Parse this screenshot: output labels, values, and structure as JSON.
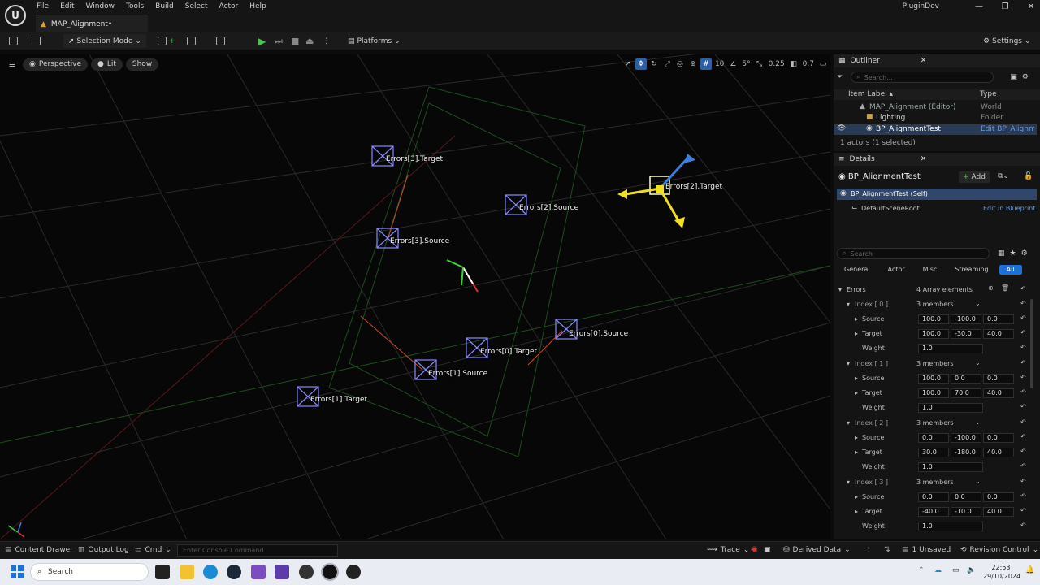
{
  "menu": [
    "File",
    "Edit",
    "Window",
    "Tools",
    "Build",
    "Select",
    "Actor",
    "Help"
  ],
  "tab_title": "MAP_Alignment•",
  "project_name": "PluginDev",
  "window_controls": [
    "—",
    "❐",
    "✕"
  ],
  "toolbar": {
    "selection_mode": "Selection Mode",
    "platforms": "Platforms",
    "settings": "Settings"
  },
  "viewport": {
    "perspective": "Perspective",
    "lit": "Lit",
    "show": "Show",
    "grid_snap": "10",
    "rot_snap": "5°",
    "scale_snap": "0.25",
    "cam_speed": "0.7"
  },
  "labels": {
    "e3t": "Errors[3].Target",
    "e2s": "Errors[2].Source",
    "e2t": "Errors[2].Target",
    "e3s": "Errors[3].Source",
    "e0s": "Errors[0].Source",
    "e0t": "Errors[0].Target",
    "e1s": "Errors[1].Source",
    "e1t": "Errors[1].Target"
  },
  "outliner": {
    "title": "Outliner",
    "search_placeholder": "Search...",
    "col_label": "Item Label ▴",
    "col_type": "Type",
    "rows": [
      {
        "label": "MAP_Alignment (Editor)",
        "type": "World"
      },
      {
        "label": "Lighting",
        "type": "Folder"
      },
      {
        "label": "BP_AlignmentTest",
        "type": "Edit BP_Alignme"
      }
    ],
    "status": "1 actors (1 selected)"
  },
  "details": {
    "title": "Details",
    "actor_name": "BP_AlignmentTest",
    "add": "Add",
    "self_row": "BP_AlignmentTest (Self)",
    "root_row": "DefaultSceneRoot",
    "edit_in_bp": "Edit in Blueprint",
    "search_placeholder": "Search",
    "categories": [
      "General",
      "Actor",
      "Misc",
      "Streaming",
      "All"
    ],
    "errors_label": "Errors",
    "errors_count": "4 Array elements",
    "members": "3 members",
    "source": "Source",
    "target": "Target",
    "weight": "Weight",
    "indices": [
      {
        "label": "Index [ 0 ]",
        "source": [
          "100.0",
          "-100.0",
          "0.0"
        ],
        "target": [
          "100.0",
          "-30.0",
          "40.0"
        ],
        "weight": "1.0"
      },
      {
        "label": "Index [ 1 ]",
        "source": [
          "100.0",
          "0.0",
          "0.0"
        ],
        "target": [
          "100.0",
          "70.0",
          "40.0"
        ],
        "weight": "1.0"
      },
      {
        "label": "Index [ 2 ]",
        "source": [
          "0.0",
          "-100.0",
          "0.0"
        ],
        "target": [
          "30.0",
          "-180.0",
          "40.0"
        ],
        "weight": "1.0"
      },
      {
        "label": "Index [ 3 ]",
        "source": [
          "0.0",
          "0.0",
          "0.0"
        ],
        "target": [
          "-40.0",
          "-10.0",
          "40.0"
        ],
        "weight": "1.0"
      }
    ]
  },
  "statusbar": {
    "content_drawer": "Content Drawer",
    "output_log": "Output Log",
    "cmd": "Cmd",
    "console_placeholder": "Enter Console Command",
    "trace": "Trace",
    "derived_data": "Derived Data",
    "unsaved": "1 Unsaved",
    "revision": "Revision Control"
  },
  "taskbar": {
    "search": "Search",
    "time": "22:53",
    "date": "29/10/2024"
  }
}
